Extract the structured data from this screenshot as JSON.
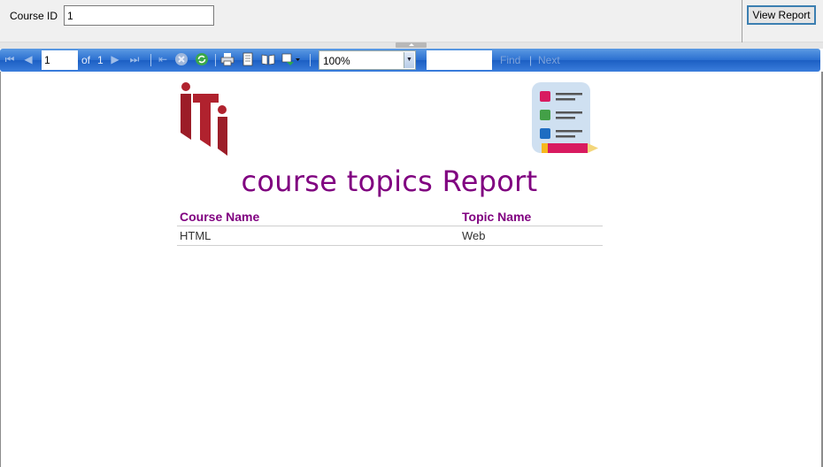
{
  "parameters": {
    "course_id_label": "Course ID",
    "course_id_value": "1",
    "view_report_label": "View Report"
  },
  "toolbar": {
    "current_page": "1",
    "of_label": "of",
    "total_pages": "1",
    "zoom": "100%",
    "find_text": "",
    "find_label": "Find",
    "separator": "|",
    "next_label": "Next"
  },
  "report": {
    "title": "course topics Report",
    "logo_left": "iti-logo",
    "logo_right": "topics-list-icon",
    "columns": [
      "Course Name",
      "Topic Name"
    ],
    "rows": [
      [
        "HTML",
        "Web"
      ]
    ]
  },
  "colors": {
    "title": "#800080",
    "toolbar": "#2b6fd0",
    "logo_red": "#b0222e"
  }
}
